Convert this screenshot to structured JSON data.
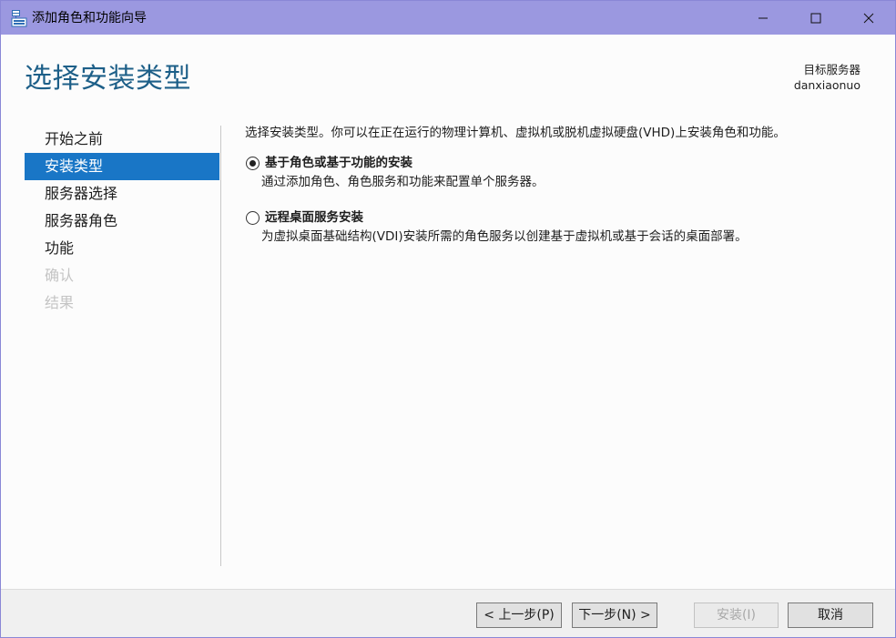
{
  "window": {
    "title": "添加角色和功能向导"
  },
  "header": {
    "page_title": "选择安装类型",
    "target_label": "目标服务器",
    "target_server": "danxiaonuo"
  },
  "nav": {
    "items": [
      {
        "label": "开始之前",
        "state": "normal"
      },
      {
        "label": "安装类型",
        "state": "active"
      },
      {
        "label": "服务器选择",
        "state": "normal"
      },
      {
        "label": "服务器角色",
        "state": "normal"
      },
      {
        "label": "功能",
        "state": "normal"
      },
      {
        "label": "确认",
        "state": "disabled"
      },
      {
        "label": "结果",
        "state": "disabled"
      }
    ]
  },
  "content": {
    "intro": "选择安装类型。你可以在正在运行的物理计算机、虚拟机或脱机虚拟硬盘(VHD)上安装角色和功能。",
    "options": [
      {
        "label": "基于角色或基于功能的安装",
        "description": "通过添加角色、角色服务和功能来配置单个服务器。",
        "checked": true
      },
      {
        "label": "远程桌面服务安装",
        "description": "为虚拟桌面基础结构(VDI)安装所需的角色服务以创建基于虚拟机或基于会话的桌面部署。",
        "checked": false
      }
    ]
  },
  "footer": {
    "prev": "< 上一步(P)",
    "next": "下一步(N) >",
    "install": "安装(I)",
    "cancel": "取消"
  },
  "colors": {
    "accent": "#1976c6",
    "title_color": "#1d5f88",
    "titlebar": "#9b98e0"
  }
}
